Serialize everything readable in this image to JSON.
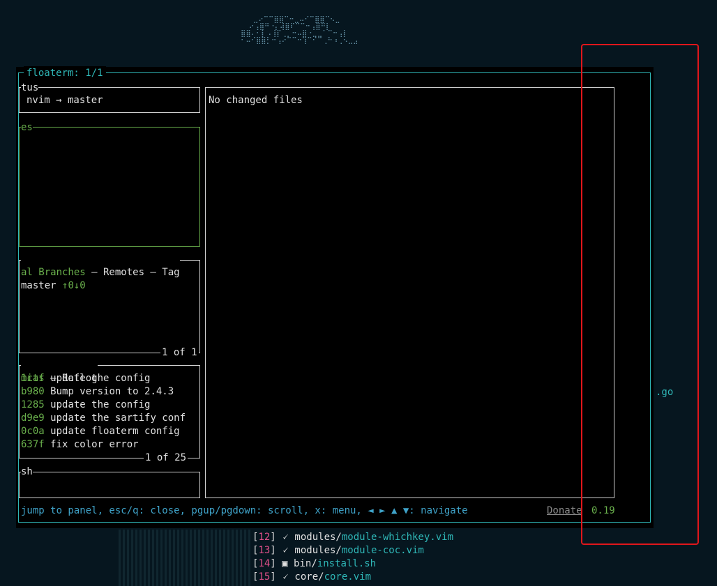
{
  "floaterm": {
    "title": "floaterm: 1/1"
  },
  "status_panel": {
    "title": "tus",
    "line": "nvim → master"
  },
  "files_panel": {
    "title": "es"
  },
  "branches_panel": {
    "title_active": "al Branches",
    "title_rest": " – Remotes – Tag",
    "branch_name": "master",
    "branch_status": "↑0↓0",
    "counter": "1 of 1"
  },
  "commits_panel": {
    "title_active": "mits",
    "title_rest": " – Reflog",
    "counter": "1 of 25",
    "commits": [
      {
        "hash": "1caf",
        "message": "update the config"
      },
      {
        "hash": "b980",
        "message": "Bump version to 2.4.3"
      },
      {
        "hash": "1285",
        "message": "update the config"
      },
      {
        "hash": "d9e9",
        "message": "update the sartify conf"
      },
      {
        "hash": "0c0a",
        "message": "update floaterm config"
      },
      {
        "hash": "637f",
        "message": "fix color error"
      }
    ]
  },
  "stash_panel": {
    "title": "sh"
  },
  "main_panel": {
    "text": "No changed files"
  },
  "status_bar": {
    "help": "jump to panel, esc/q: close, pgup/pgdown: scroll, x: menu, ◄ ► ▲ ▼: navigate",
    "donate": "Donate",
    "version": "0.19"
  },
  "side_text": ".go",
  "file_list": [
    {
      "num": "12",
      "icon": "🗸",
      "dir": "modules/",
      "file": "module-whichkey.vim"
    },
    {
      "num": "13",
      "icon": "🗸",
      "dir": "modules/",
      "file": "module-coc.vim"
    },
    {
      "num": "14",
      "icon": "▣",
      "dir": "bin/",
      "file": "install.sh"
    },
    {
      "num": "15",
      "icon": "🗸",
      "dir": "core/",
      "file": "core.vim"
    }
  ],
  "colors": {
    "accent": "#2fb7b7",
    "active_panel": "#6ab04c",
    "highlight_box": "#e0161b",
    "background": "#06161f"
  }
}
